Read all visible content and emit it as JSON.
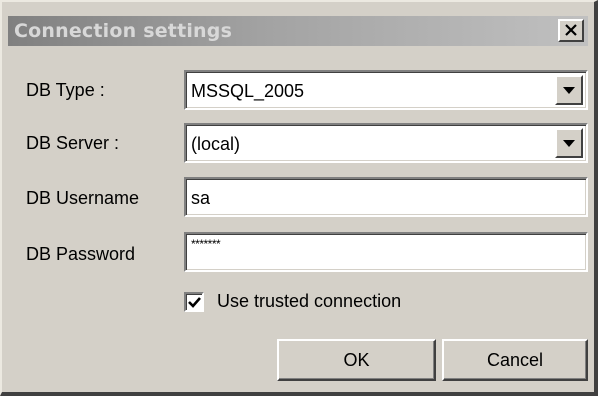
{
  "window": {
    "title": "Connection settings",
    "close_icon": "close-x-icon"
  },
  "form": {
    "db_type": {
      "label": "DB Type :",
      "value": "MSSQL_2005",
      "icon": "dropdown-arrow-icon"
    },
    "db_server": {
      "label": "DB Server :",
      "value": "(local)",
      "icon": "dropdown-arrow-icon"
    },
    "db_username": {
      "label": "DB Username",
      "value": "sa"
    },
    "db_password": {
      "label": "DB Password",
      "value": "*******"
    },
    "trusted": {
      "label": "Use trusted connection",
      "checked": true
    }
  },
  "buttons": {
    "ok": "OK",
    "cancel": "Cancel"
  },
  "colors": {
    "dialog_bg": "#d4d0c8",
    "title_gradient_start": "#808080",
    "title_gradient_end": "#c0c0c0",
    "field_bg": "#ffffff"
  }
}
